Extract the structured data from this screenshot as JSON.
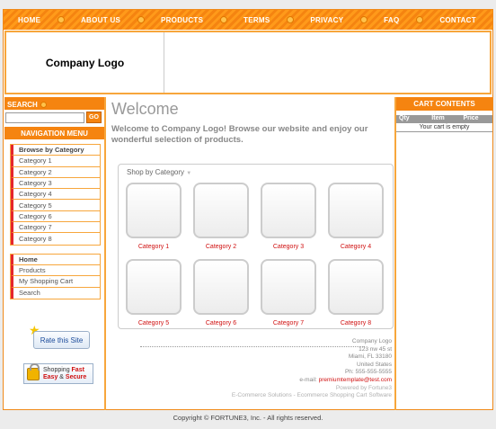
{
  "nav": {
    "items": [
      "HOME",
      "ABOUT US",
      "PRODUCTS",
      "TERMS",
      "PRIVACY",
      "FAQ",
      "CONTACT"
    ]
  },
  "header": {
    "logo_text": "Company Logo"
  },
  "search": {
    "heading": "SEARCH",
    "go_label": "GO",
    "value": ""
  },
  "navigation": {
    "heading": "NAVIGATION MENU",
    "browse_heading": "Browse by Category",
    "categories": [
      "Category 1",
      "Category 2",
      "Category 3",
      "Category 4",
      "Category 5",
      "Category 6",
      "Category 7",
      "Category 8"
    ],
    "links_heading": "Home",
    "links": [
      "Products",
      "My Shopping Cart",
      "Search"
    ]
  },
  "badges": {
    "rate_label": "Rate this Site",
    "secure_line1_a": "Shopping ",
    "secure_line1_b": "Fast",
    "secure_line2_a": "Easy",
    "secure_line2_b": " & ",
    "secure_line2_c": "Secure"
  },
  "main": {
    "title": "Welcome",
    "intro": "Welcome to  Company Logo! Browse our website and enjoy our wonderful selection of products.",
    "panel_tab": "Shop by Category",
    "categories": [
      "Category 1",
      "Category 2",
      "Category 3",
      "Category 4",
      "Category 5",
      "Category 6",
      "Category 7",
      "Category 8"
    ]
  },
  "footer": {
    "company": "Company Logo",
    "address1": "123 nw 45 st",
    "address2": "Miami, FL 33180",
    "country": "United States",
    "phone": "Ph: 555-555-5555",
    "email_label": "e-mail: ",
    "email": "premiumtemplate@test.com",
    "powered": "Powered by Fortune3",
    "software": "E-Commerce Solutions - Ecommerce Shopping Cart Software"
  },
  "cart": {
    "heading": "CART CONTENTS",
    "columns": [
      "Qty",
      "Item",
      "Price"
    ],
    "empty_text": "Your cart is empty"
  },
  "copyright": "Copyright © FORTUNE3, Inc. - All rights reserved.",
  "colors": {
    "accent": "#f58410",
    "link_red": "#d01010"
  }
}
